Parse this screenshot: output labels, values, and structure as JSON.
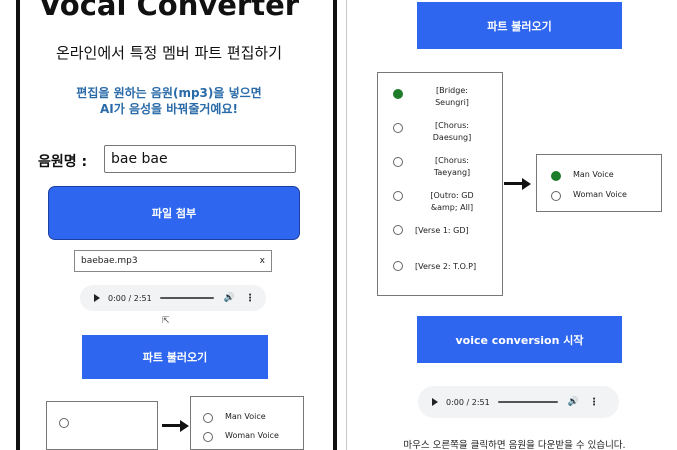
{
  "app": {
    "title": "Vocal Converter",
    "subtitle": "온라인에서 특정 멤버 파트 편집하기",
    "instruction_line1": "편집을 원하는 음원(mp3)을 넣으면",
    "instruction_line2": "AI가 음성을 바꿔줄거예요!"
  },
  "form": {
    "song_label": "음원명 :",
    "song_value": "bae bae",
    "attach_button": "파일 첨부",
    "file_name": "baebae.mp3",
    "file_clear": "x",
    "load_parts_button": "파트 불러오기"
  },
  "audio_player": {
    "time": "0:00 / 2:51",
    "play_icon": "play-icon",
    "volume_icon": "volume-icon",
    "more_icon": "more-vert-icon"
  },
  "parts": {
    "selected_index": 0,
    "items": [
      "[Bridge: Seungri]",
      "[Chorus: Daesung]",
      "[Chorus: Taeyang]",
      "[Outro: GD &amp; All]",
      "[Verse 1: GD]",
      "[Verse 2: T.O.P]"
    ]
  },
  "voices": {
    "selected_index": 0,
    "items": [
      "Man Voice",
      "Woman Voice"
    ]
  },
  "conversion": {
    "start_button": "voice conversion 시작",
    "download_hint": "마우스 오른쪽을 클릭하면 음원을 다운받을 수 있습니다."
  },
  "colors": {
    "primary_button": "#2e66f0",
    "instruction_text": "#2a6aa8",
    "selected_radio": "#1e7d2a"
  }
}
